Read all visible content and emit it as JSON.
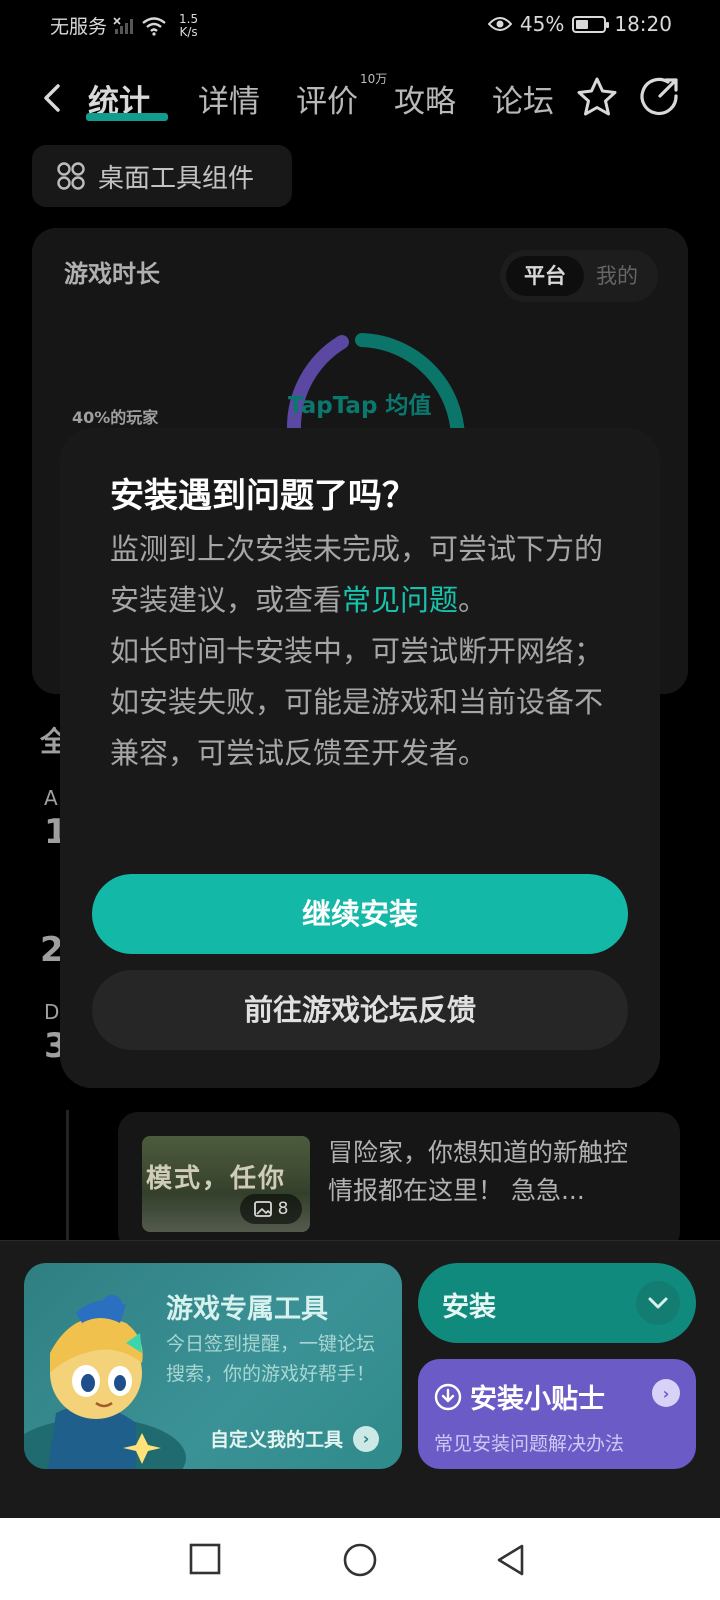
{
  "status_bar": {
    "carrier": "无服务",
    "net_speed_value": "1.5",
    "net_speed_unit": "K/s",
    "battery": "45%",
    "battery_level": 0.45,
    "time": "18:20"
  },
  "nav": {
    "tabs": [
      {
        "label": "统计",
        "active": true
      },
      {
        "label": "详情",
        "active": false
      },
      {
        "label": "评价",
        "active": false
      },
      {
        "label": "攻略",
        "active": false
      },
      {
        "label": "论坛",
        "active": false
      }
    ],
    "review_count": "10万"
  },
  "widget_button": {
    "label": "桌面工具组件"
  },
  "stats_card": {
    "title": "游戏时长",
    "toggle": {
      "platform": "平台",
      "mine": "我的"
    },
    "players_label": "40%的玩家",
    "ring_label": "TapTap 均值"
  },
  "background_list": {
    "section_initial": "全",
    "row_a_letter": "A",
    "row_a_num": "1",
    "row_b_num": "2",
    "row_d_letter": "D",
    "row_d_num": "3"
  },
  "feed_item": {
    "thumb_text": "模式，任你",
    "image_count": "8",
    "text": "冒险家，你想知道的新触控情报都在这里！ 急急..."
  },
  "dialog": {
    "title": "安装遇到问题了吗？",
    "body_part1": "监测到上次安装未完成，可尝试下方的安装建议，或查看",
    "body_link": "常见问题",
    "body_part2": "。",
    "body_line2": "如长时间卡安装中，可尝试断开网络；",
    "body_line3": "如安装失败，可能是游戏和当前设备不兼容，可尝试反馈至开发者。",
    "primary_button": "继续安装",
    "secondary_button": "前往游戏论坛反馈"
  },
  "bottom": {
    "tools_title": "游戏专属工具",
    "tools_desc": "今日签到提醒，一键论坛搜索，你的游戏好帮手！",
    "tools_link": "自定义我的工具",
    "install_label": "安装",
    "tips_title": "安装小贴士",
    "tips_desc": "常见安装问题解决办法"
  },
  "colors": {
    "accent": "#14b8a6",
    "link": "#17c2ad",
    "purple": "#6b5bc6"
  }
}
